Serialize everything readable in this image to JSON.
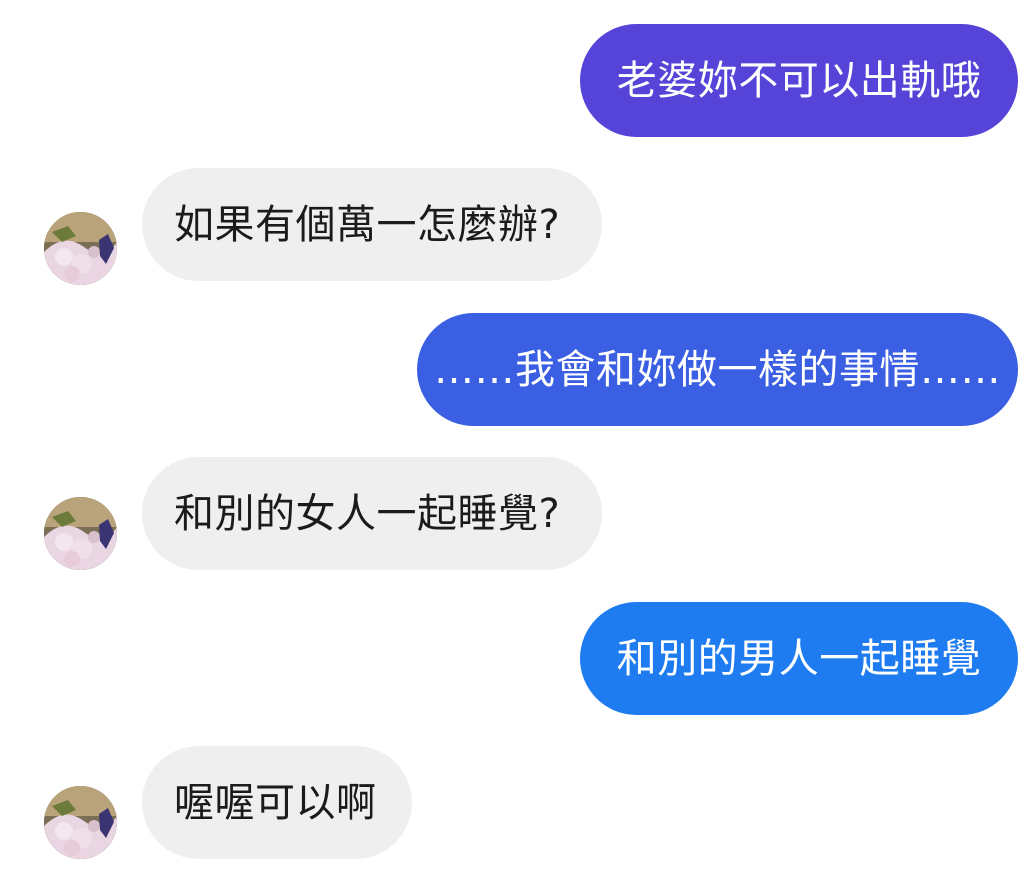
{
  "messages": [
    {
      "sender": "me",
      "text": "老婆妳不可以出軌哦",
      "color": "#5644d8"
    },
    {
      "sender": "other",
      "text": "如果有個萬一怎麼辦?"
    },
    {
      "sender": "me",
      "text": "……我會和妳做一樣的事情……",
      "color": "#3a5fe2"
    },
    {
      "sender": "other",
      "text": "和別的女人一起睡覺?"
    },
    {
      "sender": "me",
      "text": "和別的男人一起睡覺",
      "color": "#1e7cf0"
    },
    {
      "sender": "other",
      "text": "喔喔可以啊"
    }
  ],
  "avatar": {
    "icon": "profile-avatar-icon"
  },
  "colors": {
    "incoming_bubble": "#efeff0",
    "incoming_text": "#1b1b1b",
    "outgoing_text": "#ffffff"
  }
}
